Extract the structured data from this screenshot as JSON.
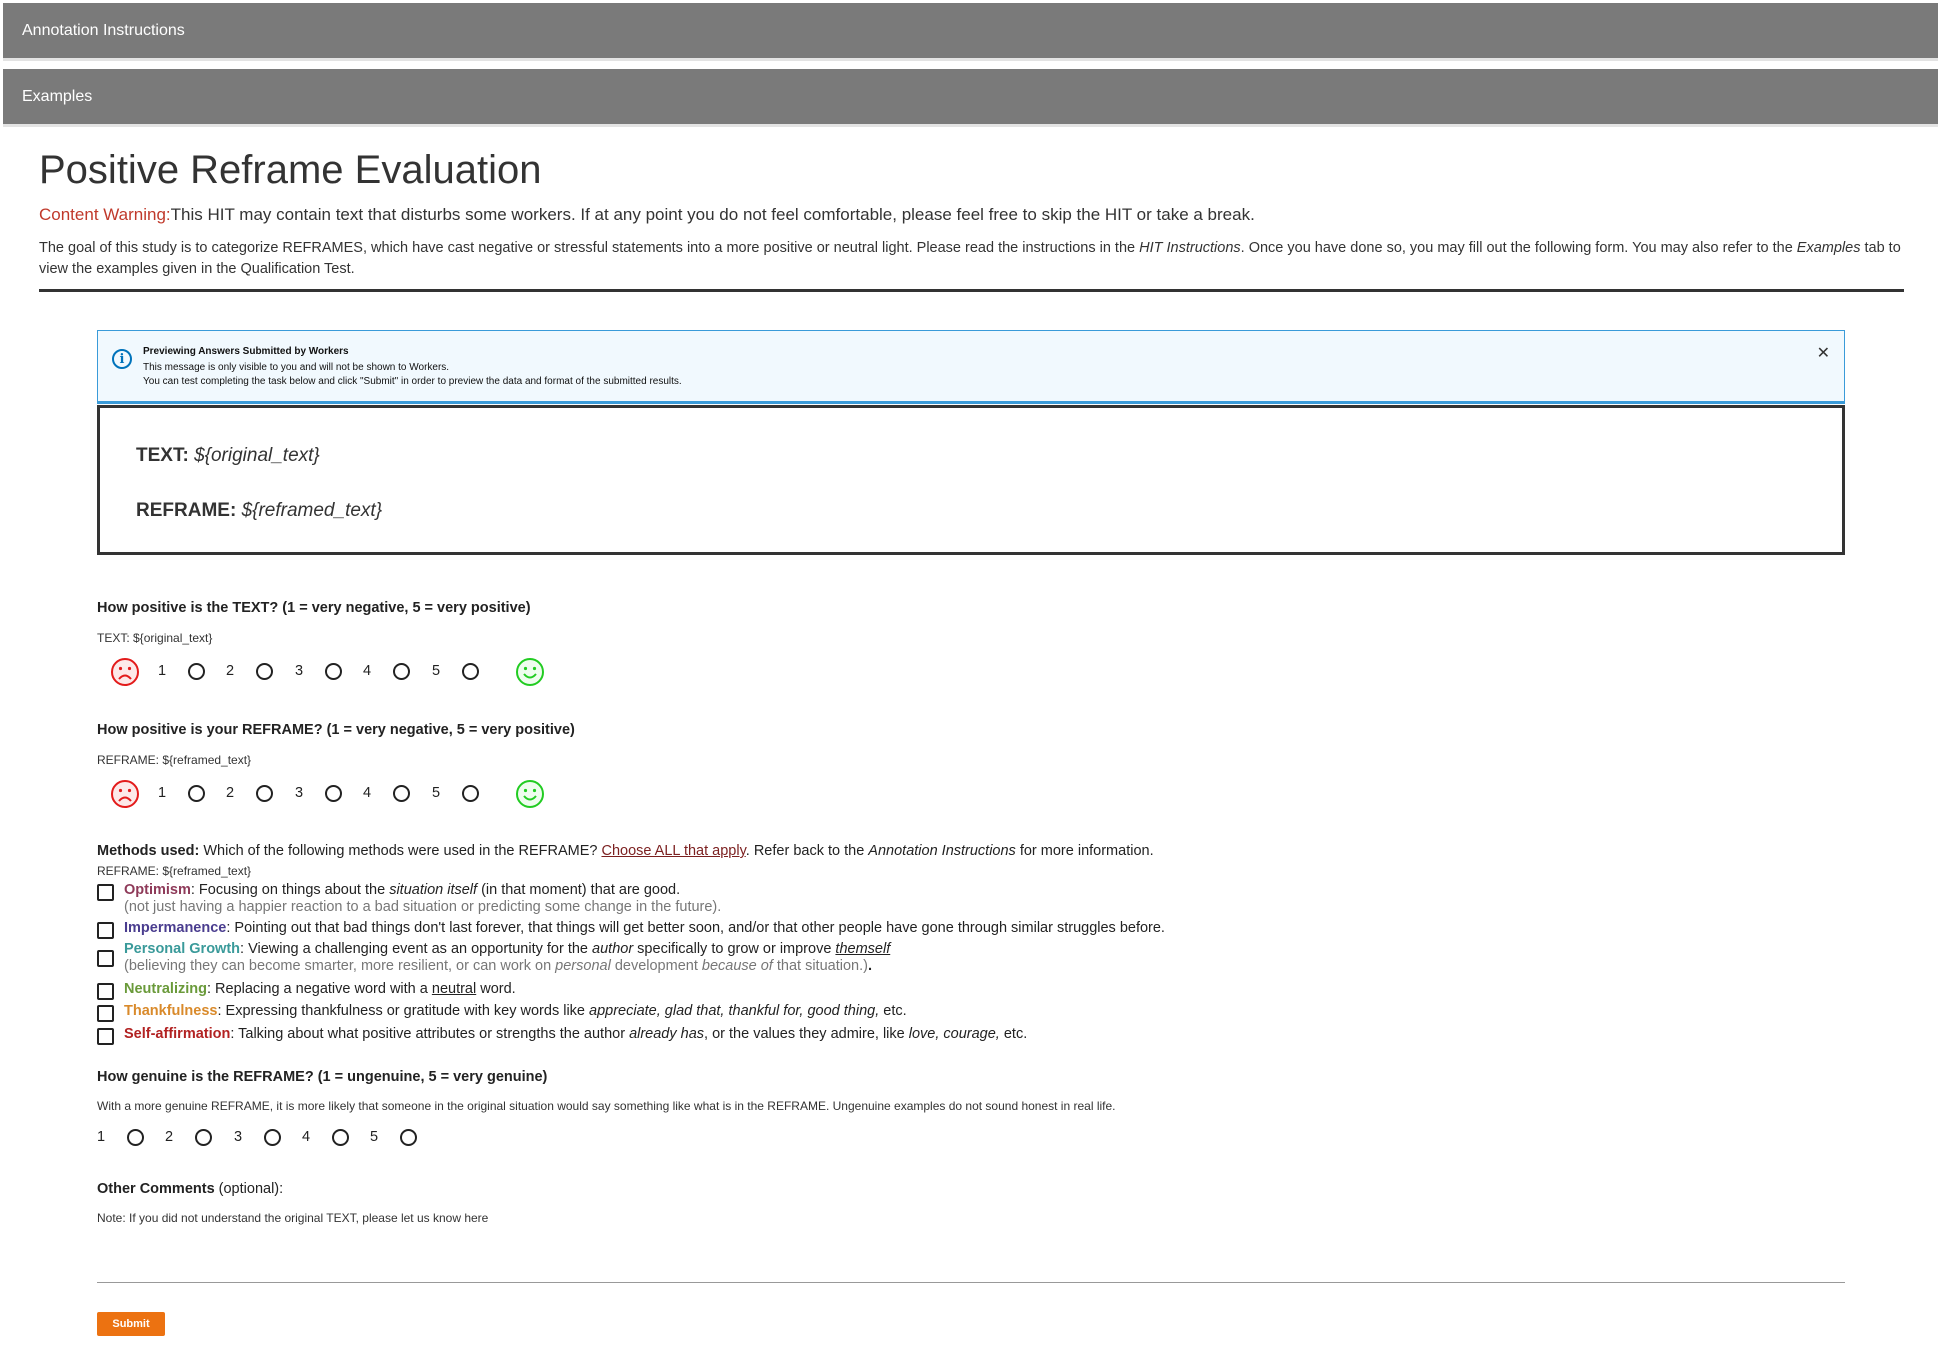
{
  "accordions": {
    "instructions": "Annotation Instructions",
    "examples": "Examples"
  },
  "header": {
    "title": "Positive Reframe Evaluation",
    "warning_label": "Content Warning:",
    "warning_text": "This HIT may contain text that disturbs some workers. If at any point you do not feel comfortable, please feel free to skip the HIT or take a break.",
    "goal_part1": "The goal of this study is to categorize REFRAMES, which have cast negative or stressful statements into a more positive or neutral light. Please read the instructions in the ",
    "goal_em1": "HIT Instructions",
    "goal_part2": ". Once you have done so, you may fill out the following form. You may also refer to the ",
    "goal_em2": "Examples",
    "goal_part3": " tab to view the examples given in the Qualification Test."
  },
  "preview": {
    "title": "Previewing Answers Submitted by Workers",
    "line1": "This message is only visible to you and will not be shown to Workers.",
    "line2": "You can test completing the task below and click \"Submit\" in order to preview the data and format of the submitted results.",
    "info_icon": "info-icon",
    "close_icon": "close-icon",
    "close_glyph": "✕"
  },
  "text_box": {
    "text_label": "TEXT:",
    "text_value": "${original_text}",
    "reframe_label": "REFRAME:",
    "reframe_value": "${reframed_text}"
  },
  "q1": {
    "title": "How positive is the TEXT? (1 = very negative, 5 = very positive)",
    "sub": "TEXT: ${original_text}",
    "options": [
      "1",
      "2",
      "3",
      "4",
      "5"
    ]
  },
  "q2": {
    "title": "How positive is your REFRAME? (1 = very negative, 5 = very positive)",
    "sub": "REFRAME: ${reframed_text}",
    "options": [
      "1",
      "2",
      "3",
      "4",
      "5"
    ]
  },
  "faces": {
    "negative": "sad-face-icon",
    "positive": "happy-face-icon",
    "negative_color": "#e31b1b",
    "positive_color": "#22cc22"
  },
  "methods": {
    "label": "Methods used:",
    "question": " Which of the following methods were used in the REFRAME? ",
    "link": "Choose ALL that apply",
    "after_link": ". Refer back to the ",
    "em": "Annotation Instructions",
    "tail": " for more information.",
    "sub": "REFRAME: ${reframed_text}",
    "items": [
      {
        "name": "Optimism",
        "color": "#8e3a59",
        "a": ": Focusing on things about the ",
        "b": "situation itself",
        "c": " (in that moment) that are good.",
        "note": "(not just having a happier reaction to a bad situation or predicting some change in the future)."
      },
      {
        "name": "Impermanence",
        "color": "#4a3d8f",
        "a": ": Pointing out that bad things don't last forever, that things will get better soon, and/or that other people have gone through similar struggles before."
      },
      {
        "name": "Personal Growth",
        "color": "#3a9a9a",
        "a": ": Viewing a challenging event as an opportunity for the ",
        "b": "author",
        "c": " specifically to grow or improve ",
        "d": "themself",
        "note1": "(believing they can become smarter, more resilient, or can work on ",
        "note_em1": "personal",
        "note2": " development ",
        "note_em2": "because of",
        "note3": " that situation.)",
        "note_end": "."
      },
      {
        "name": "Neutralizing",
        "color": "#6a9a3a",
        "a": ": Replacing a negative word with a ",
        "b": "neutral",
        "c": " word."
      },
      {
        "name": "Thankfulness",
        "color": "#d98a2b",
        "a": ": Expressing thankfulness or gratitude with key words like ",
        "b": "appreciate, glad that, thankful for, good thing,",
        "c": " etc."
      },
      {
        "name": "Self-affirmation",
        "color": "#b22222",
        "a": ": Talking about what positive attributes or strengths the author ",
        "b": "already has",
        "c": ", or the values they admire, like ",
        "d": "love, courage,",
        "e": " etc."
      }
    ]
  },
  "q3": {
    "title": "How genuine is the REFRAME? (1 = ungenuine, 5 = very genuine)",
    "sub": "With a more genuine REFRAME, it is more likely that someone in the original situation would say something like what is in the REFRAME. Ungenuine examples do not sound honest in real life.",
    "options": [
      "1",
      "2",
      "3",
      "4",
      "5"
    ]
  },
  "comments": {
    "label": "Other Comments",
    "optional": " (optional):",
    "note": "Note: If you did not understand the original TEXT, please let us know here"
  },
  "submit_label": "Submit"
}
